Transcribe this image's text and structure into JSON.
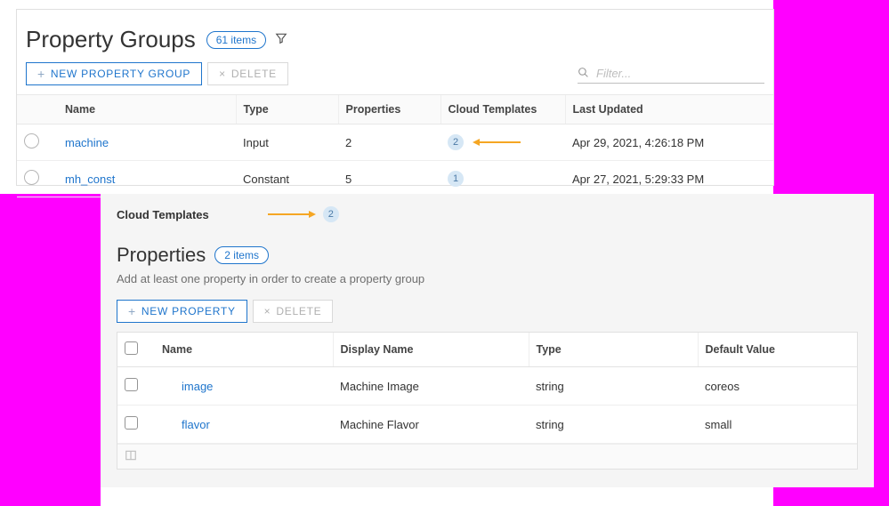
{
  "header": {
    "title": "Property Groups",
    "count_label": "61 items"
  },
  "toolbar": {
    "new_label": "NEW PROPERTY GROUP",
    "delete_label": "DELETE",
    "filter_placeholder": "Filter..."
  },
  "columns": {
    "name": "Name",
    "type": "Type",
    "properties": "Properties",
    "cloud_templates": "Cloud Templates",
    "last_updated": "Last Updated"
  },
  "rows": [
    {
      "name": "machine",
      "type": "Input",
      "properties": "2",
      "cloud_templates": "2",
      "last_updated": "Apr 29, 2021, 4:26:18 PM"
    },
    {
      "name": "mh_const",
      "type": "Constant",
      "properties": "5",
      "cloud_templates": "1",
      "last_updated": "Apr 27, 2021, 5:29:33 PM"
    }
  ],
  "detail": {
    "cloud_templates_label": "Cloud Templates",
    "cloud_templates_count": "2",
    "properties_title": "Properties",
    "properties_count_label": "2 items",
    "hint": "Add at least one property in order to create a property group",
    "new_prop_label": "NEW PROPERTY",
    "delete_label": "DELETE",
    "columns": {
      "name": "Name",
      "display_name": "Display Name",
      "type": "Type",
      "default_value": "Default Value"
    },
    "rows": [
      {
        "name": "image",
        "display_name": "Machine Image",
        "type": "string",
        "default_value": "coreos"
      },
      {
        "name": "flavor",
        "display_name": "Machine Flavor",
        "type": "string",
        "default_value": "small"
      }
    ]
  }
}
